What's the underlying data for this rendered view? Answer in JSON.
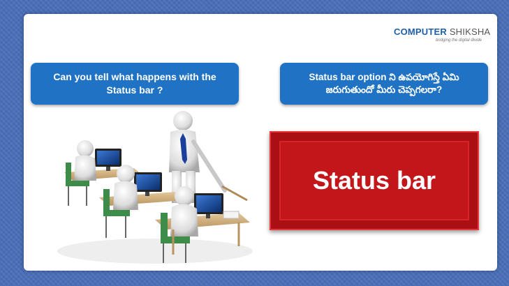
{
  "logo": {
    "brand_part1": "COMPUTER",
    "brand_part2": "SHIKSHA",
    "tagline": "bridging the digital divide"
  },
  "question_english": {
    "line1": "Can you tell what happens with the",
    "line2": "Status bar ?"
  },
  "question_telugu": {
    "line1": "Status bar option ని ఉపయోగిస్తే ఏమి",
    "line2": "జరుగుతుందో మీరు చెప్పగలరా?"
  },
  "highlight_button": {
    "label": "Status bar"
  },
  "colors": {
    "background": "#4a6fb8",
    "question_box": "#1f72c4",
    "button_red": "#c2161b",
    "brand_blue": "#1e5fa8"
  },
  "illustration": "classroom-computers-illustration"
}
